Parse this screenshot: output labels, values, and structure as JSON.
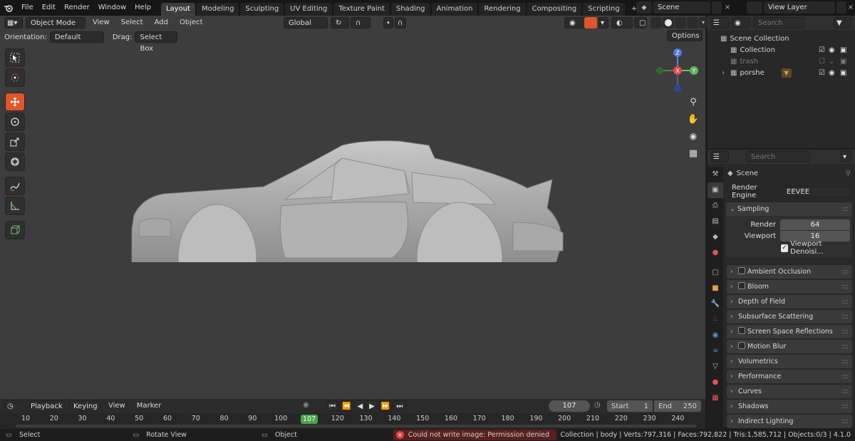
{
  "topbar": {
    "menus": [
      "File",
      "Edit",
      "Render",
      "Window",
      "Help"
    ],
    "workspaces": [
      "Layout",
      "Modeling",
      "Sculpting",
      "UV Editing",
      "Texture Paint",
      "Shading",
      "Animation",
      "Rendering",
      "Compositing",
      "Scripting"
    ],
    "active_workspace": "Layout",
    "add_tab": "+",
    "scene": "Scene",
    "view_layer": "View Layer"
  },
  "viewport": {
    "mode": "Object Mode",
    "menus": [
      "View",
      "Select",
      "Add",
      "Object"
    ],
    "transform_orientation": "Global",
    "orientation_label": "Orientation:",
    "orientation_value": "Default",
    "drag_label": "Drag:",
    "drag_value": "Select Box",
    "options": "Options",
    "gizmo": {
      "z": "Z",
      "x": "X",
      "y": "Y"
    }
  },
  "outliner": {
    "search_placeholder": "Search",
    "root": "Scene Collection",
    "items": [
      {
        "label": "Collection",
        "dim": false
      },
      {
        "label": "trash",
        "dim": true
      },
      {
        "label": "porshe",
        "dim": false
      }
    ]
  },
  "properties": {
    "search_placeholder": "Search",
    "context": "Scene",
    "render_engine_label": "Render Engine",
    "render_engine": "EEVEE",
    "sampling": {
      "title": "Sampling",
      "render_label": "Render",
      "render_value": "64",
      "viewport_label": "Viewport",
      "viewport_value": "16",
      "denoise_label": "Viewport Denoisi..."
    },
    "sections": [
      {
        "label": "Ambient Occlusion",
        "checkbox": true
      },
      {
        "label": "Bloom",
        "checkbox": true
      },
      {
        "label": "Depth of Field",
        "checkbox": false
      },
      {
        "label": "Subsurface Scattering",
        "checkbox": false
      },
      {
        "label": "Screen Space Reflections",
        "checkbox": true
      },
      {
        "label": "Motion Blur",
        "checkbox": true
      },
      {
        "label": "Volumetrics",
        "checkbox": false
      },
      {
        "label": "Performance",
        "checkbox": false
      },
      {
        "label": "Curves",
        "checkbox": false
      },
      {
        "label": "Shadows",
        "checkbox": false
      },
      {
        "label": "Indirect Lighting",
        "checkbox": false
      }
    ]
  },
  "timeline": {
    "menus": [
      "Playback",
      "Keying",
      "View",
      "Marker"
    ],
    "current_frame": "107",
    "start_label": "Start",
    "start": "1",
    "end_label": "End",
    "end": "250",
    "ruler": [
      "10",
      "20",
      "30",
      "40",
      "50",
      "60",
      "70",
      "80",
      "90",
      "100",
      "107",
      "120",
      "130",
      "140",
      "150",
      "160",
      "170",
      "180",
      "190",
      "200",
      "210",
      "220",
      "230",
      "240"
    ]
  },
  "status": {
    "select": "Select",
    "rotate": "Rotate View",
    "object": "Object",
    "error": "Could not write image: Permission denied",
    "stats": "Collection | body | Verts:797,316 | Faces:792,822 | Tris:1,585,712 | Objects:0/3 | 4.1.0"
  },
  "colors": {
    "accent": "#e0552a",
    "frame_green": "#4aa34a",
    "error_red": "#c33b3b"
  }
}
